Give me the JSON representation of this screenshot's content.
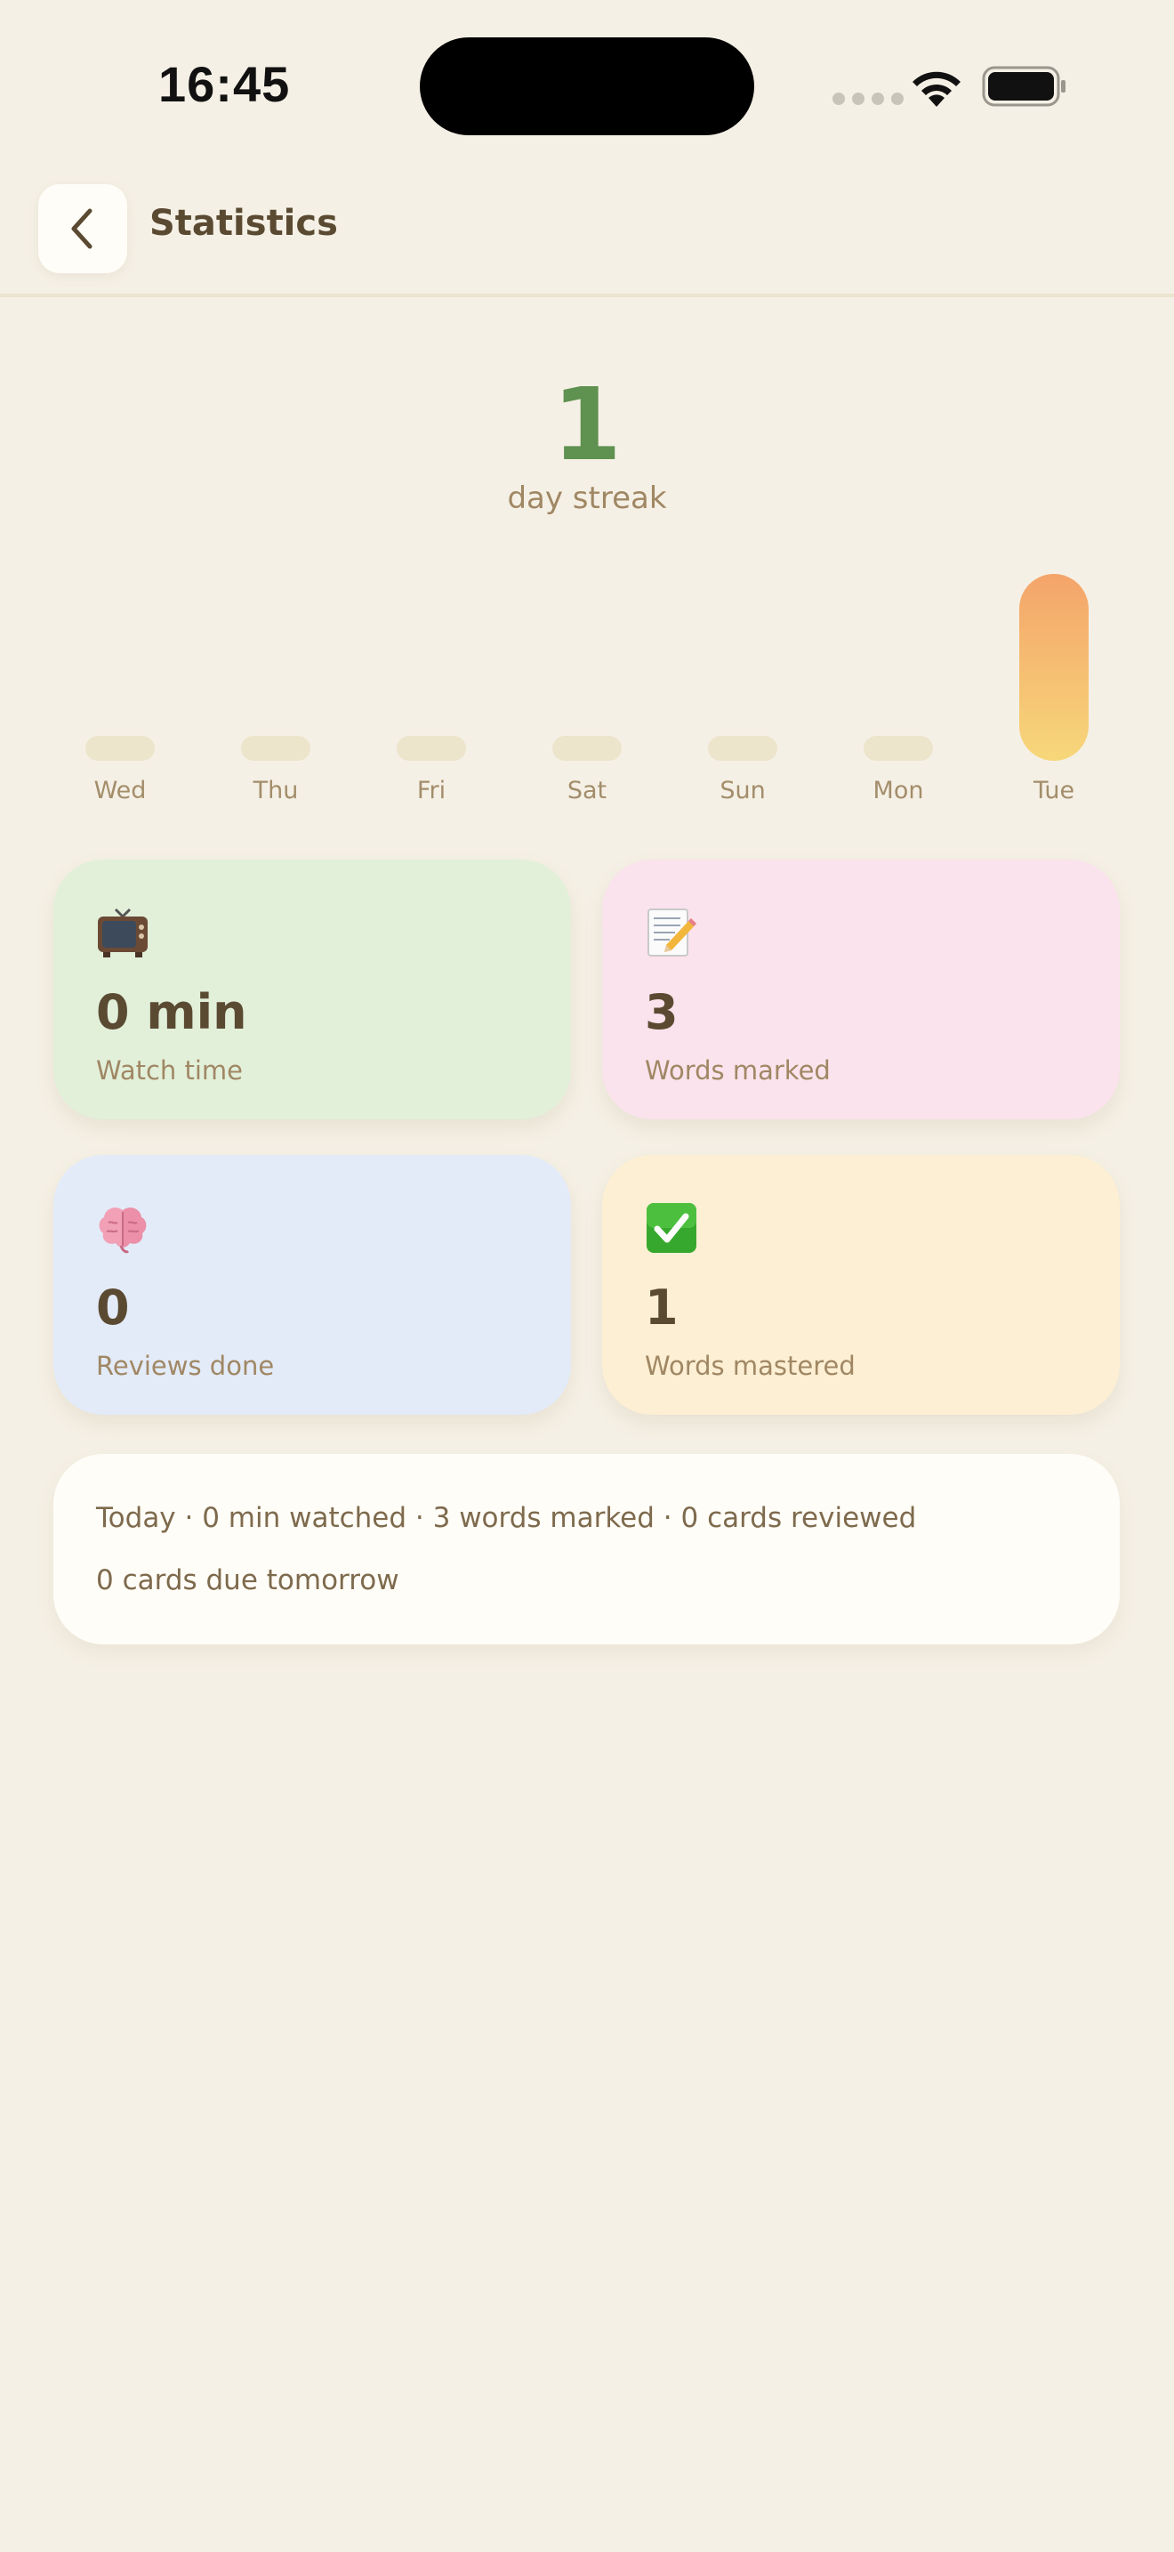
{
  "status_bar": {
    "time": "16:45"
  },
  "header": {
    "title": "Statistics",
    "back_icon": "chevron-left-icon"
  },
  "streak": {
    "value": "1",
    "label": "day streak",
    "color": "#5f9150"
  },
  "week_chart": {
    "days": [
      "Wed",
      "Thu",
      "Fri",
      "Sat",
      "Sun",
      "Mon",
      "Tue"
    ],
    "values": [
      0,
      0,
      0,
      0,
      0,
      0,
      1
    ],
    "active_colors": [
      "#f4a46a",
      "#f7d77a"
    ],
    "inactive_color": "#ede4cc"
  },
  "cards": {
    "watch": {
      "icon": "television-icon",
      "value": "0 min",
      "label": "Watch time",
      "color": "#e2f0da"
    },
    "words": {
      "icon": "memo-pencil-icon",
      "value": "3",
      "label": "Words marked",
      "color": "#fae3ec"
    },
    "reviews": {
      "icon": "brain-icon",
      "value": "0",
      "label": "Reviews done",
      "color": "#e3ebf8"
    },
    "mastered": {
      "icon": "check-mark-button-icon",
      "value": "1",
      "label": "Words mastered",
      "color": "#fdefd3"
    }
  },
  "summary": {
    "line1": "Today · 0 min watched · 3 words marked · 0 cards reviewed",
    "line2": "0 cards due tomorrow"
  }
}
